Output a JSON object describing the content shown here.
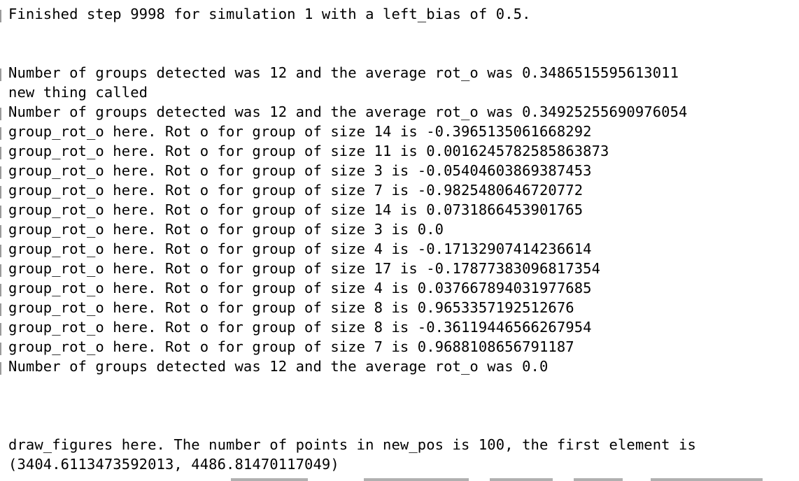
{
  "terminal": {
    "lines": [
      "Finished step 9998 for simulation 1 with a left_bias of 0.5.",
      "",
      "",
      "Number of groups detected was 12 and the average rot_o was 0.3486515595613011",
      "new thing called",
      "Number of groups detected was 12 and the average rot_o was 0.34925255690976054",
      "group_rot_o here. Rot o for group of size 14 is -0.3965135061668292",
      "group_rot_o here. Rot o for group of size 11 is 0.0016245782585863873",
      "group_rot_o here. Rot o for group of size 3 is -0.05404603869387453",
      "group_rot_o here. Rot o for group of size 7 is -0.9825480646720772",
      "group_rot_o here. Rot o for group of size 14 is 0.0731866453901765",
      "group_rot_o here. Rot o for group of size 3 is 0.0",
      "group_rot_o here. Rot o for group of size 4 is -0.17132907414236614",
      "group_rot_o here. Rot o for group of size 17 is -0.17877383096817354",
      "group_rot_o here. Rot o for group of size 4 is 0.037667894031977685",
      "group_rot_o here. Rot o for group of size 8 is 0.9653357192512676",
      "group_rot_o here. Rot o for group of size 8 is -0.36119446566267954",
      "group_rot_o here. Rot o for group of size 7 is 0.9688108656791187",
      "Number of groups detected was 12 and the average rot_o was 0.0",
      "",
      "",
      "",
      "draw_figures here. The number of points in new_pos is 100, the first element is",
      "(3404.6113473592013, 4486.81470117049)"
    ]
  }
}
